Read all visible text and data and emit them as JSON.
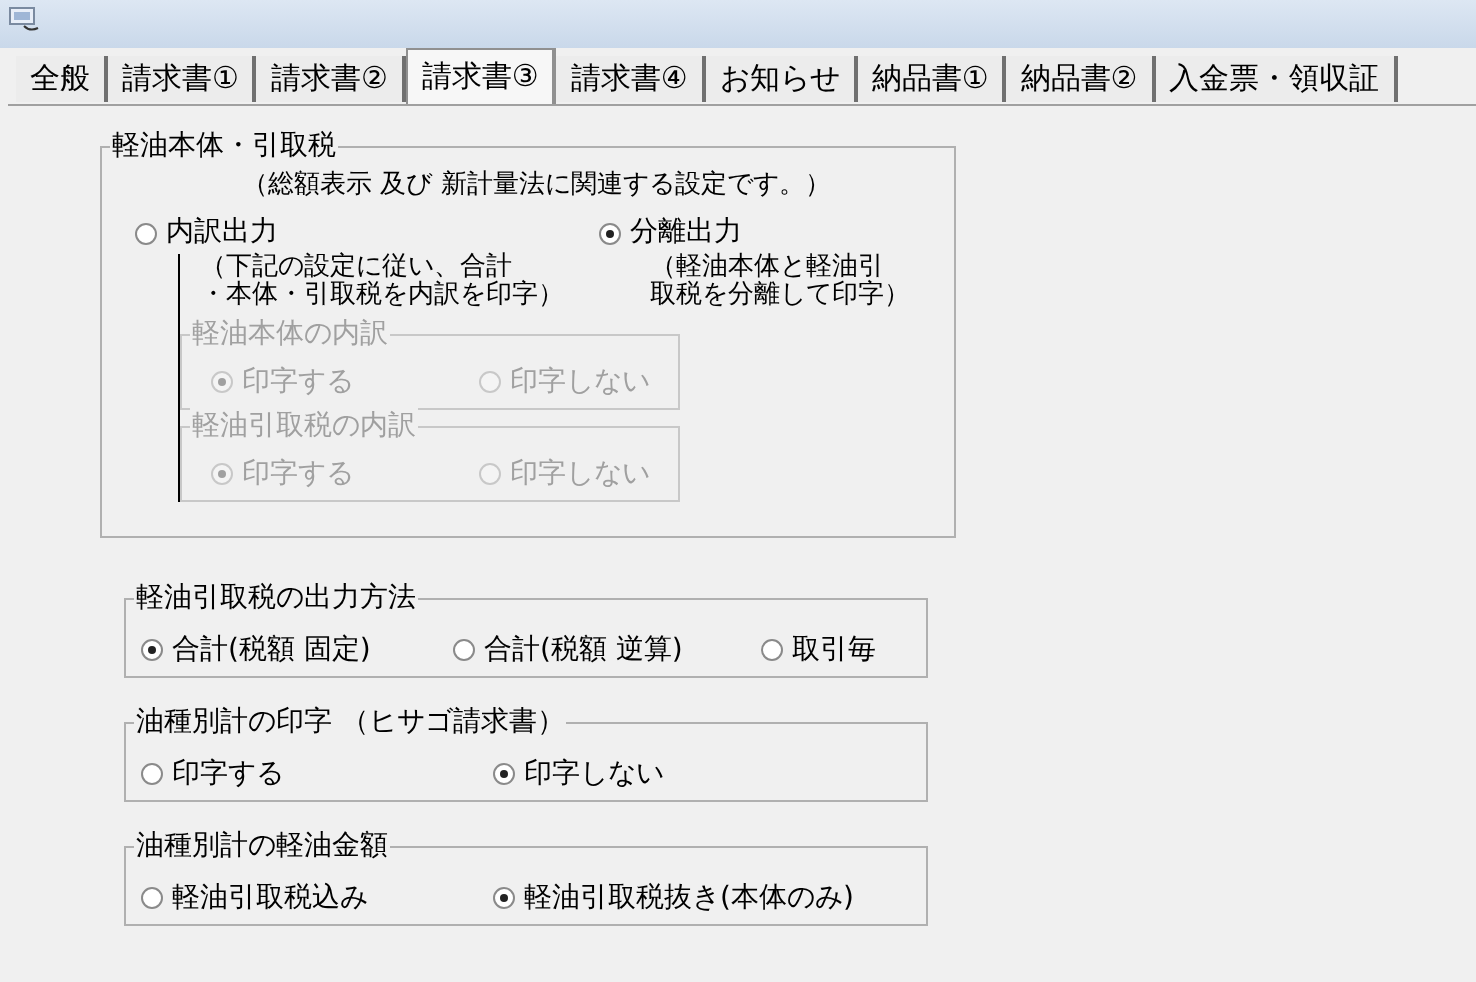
{
  "tabs": [
    {
      "label": "全般",
      "selected": false
    },
    {
      "label": "請求書①",
      "selected": false
    },
    {
      "label": "請求書②",
      "selected": false
    },
    {
      "label": "請求書③",
      "selected": true
    },
    {
      "label": "請求書④",
      "selected": false
    },
    {
      "label": "お知らせ",
      "selected": false
    },
    {
      "label": "納品書①",
      "selected": false
    },
    {
      "label": "納品書②",
      "selected": false
    },
    {
      "label": "入金票・領収証",
      "selected": false
    }
  ],
  "main_group": {
    "title": "軽油本体・引取税",
    "note": "（総額表示 及び 新計量法に関連する設定です。）",
    "options": [
      {
        "label": "内訳出力",
        "selected": false,
        "description": [
          "（下記の設定に従い、合計",
          "・本体・引取税を内訳を印字）"
        ]
      },
      {
        "label": "分離出力",
        "selected": true,
        "description": [
          "（軽油本体と軽油引",
          "取税を分離して印字）"
        ]
      }
    ],
    "subgroups": [
      {
        "title": "軽油本体の内訳",
        "disabled": true,
        "options": [
          {
            "label": "印字する",
            "selected": true
          },
          {
            "label": "印字しない",
            "selected": false
          }
        ]
      },
      {
        "title": "軽油引取税の内訳",
        "disabled": true,
        "options": [
          {
            "label": "印字する",
            "selected": true
          },
          {
            "label": "印字しない",
            "selected": false
          }
        ]
      }
    ]
  },
  "groups": [
    {
      "title": "軽油引取税の出力方法",
      "options": [
        {
          "label": "合計(税額 固定)",
          "selected": true
        },
        {
          "label": "合計(税額 逆算)",
          "selected": false
        },
        {
          "label": "取引毎",
          "selected": false
        }
      ]
    },
    {
      "title": "油種別計の印字 （ヒサゴ請求書）",
      "options": [
        {
          "label": "印字する",
          "selected": false
        },
        {
          "label": "印字しない",
          "selected": true
        }
      ]
    },
    {
      "title": "油種別計の軽油金額",
      "options": [
        {
          "label": "軽油引取税込み",
          "selected": false
        },
        {
          "label": "軽油引取税抜き(本体のみ)",
          "selected": true
        }
      ]
    }
  ]
}
